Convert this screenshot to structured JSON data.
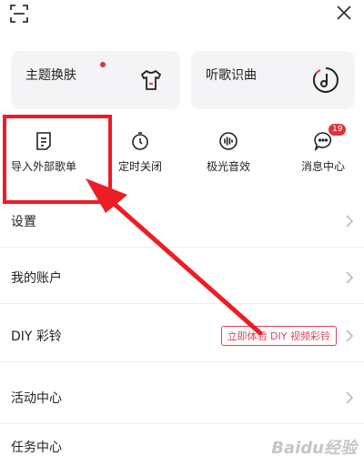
{
  "header": {
    "scan_icon": "scan-icon",
    "close_icon": "close-icon"
  },
  "cards": {
    "theme": {
      "label": "主题换肤",
      "icon": "tshirt-icon",
      "has_dot": true
    },
    "song_recognition": {
      "label": "听歌识曲",
      "icon": "music-note-icon"
    }
  },
  "shortcuts": [
    {
      "label": "导入外部歌单",
      "icon": "import-list-icon"
    },
    {
      "label": "定时关闭",
      "icon": "timer-icon"
    },
    {
      "label": "极光音效",
      "icon": "sound-wave-icon"
    },
    {
      "label": "消息中心",
      "icon": "message-icon",
      "badge": "19"
    }
  ],
  "menu": {
    "settings": "设置",
    "account": "我的账户",
    "diy": "DIY 彩铃",
    "diy_promo": "立即体验 DIY 视频彩铃",
    "activity": "活动中心",
    "task": "任务中心"
  },
  "watermark": "Baidu经验",
  "colors": {
    "accent_red": "#e0303c",
    "annotation_red": "#ee1c25",
    "card_bg": "#f4f4f6"
  }
}
